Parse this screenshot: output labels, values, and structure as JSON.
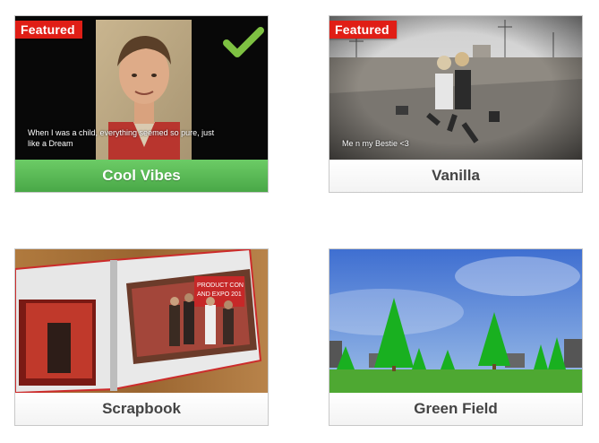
{
  "themes": [
    {
      "name": "Cool Vibes",
      "featured": true,
      "badge": "Featured",
      "selected": true,
      "caption": "When I was a child, everything seemed so pure, just like a Dream",
      "icon": "checkmark-icon"
    },
    {
      "name": "Vanilla",
      "featured": true,
      "badge": "Featured",
      "selected": false,
      "caption": "Me n my Bestie <3"
    },
    {
      "name": "Scrapbook",
      "featured": false,
      "selected": false,
      "thumbnail_text": [
        "PRODUCT CON",
        "AND EXPO 201"
      ]
    },
    {
      "name": "Green Field",
      "featured": false,
      "selected": false
    }
  ],
  "colors": {
    "featured_badge": "#e01e16",
    "selected_bar": "#55b553",
    "check": "#7ec142"
  }
}
